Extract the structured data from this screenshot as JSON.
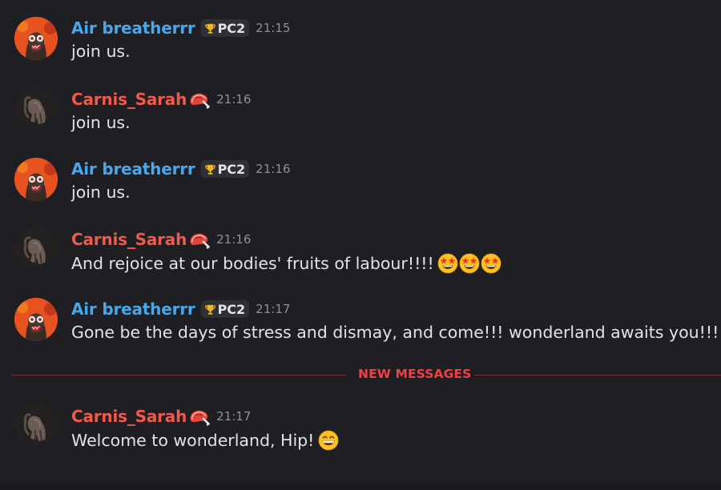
{
  "divider": {
    "label": "NEW MESSAGES"
  },
  "messages": [
    {
      "author": "Air breatherrr",
      "tag": "PC2",
      "time": "21:15",
      "text": "join us."
    },
    {
      "author": "Carnis_Sarah",
      "time": "21:16",
      "text": "join us."
    },
    {
      "author": "Air breatherrr",
      "tag": "PC2",
      "time": "21:16",
      "text": "join us."
    },
    {
      "author": "Carnis_Sarah",
      "time": "21:16",
      "text": "And rejoice at our bodies' fruits of labour!!!!",
      "emojis": [
        "star-struck-emoji",
        "star-struck-emoji",
        "star-struck-emoji"
      ]
    },
    {
      "author": "Air breatherrr",
      "tag": "PC2",
      "time": "21:17",
      "text": "Gone be the days of stress and dismay, and come!!! wonderland awaits you!!!"
    },
    {
      "author": "Carnis_Sarah",
      "time": "21:17",
      "text": "Welcome to wonderland, Hip!",
      "emojis": [
        "grinning-emoji"
      ]
    }
  ],
  "icons": {
    "name_decoration_carnis": "steak-icon",
    "tag_icon": "trophy-icon"
  },
  "colors": {
    "background": "#1f1f23",
    "air_breatherrr_name": "#47a7ea",
    "carnis_sarah_name": "#ef5a4b",
    "new_messages": "#f23f43",
    "timestamp": "#8e9098"
  }
}
